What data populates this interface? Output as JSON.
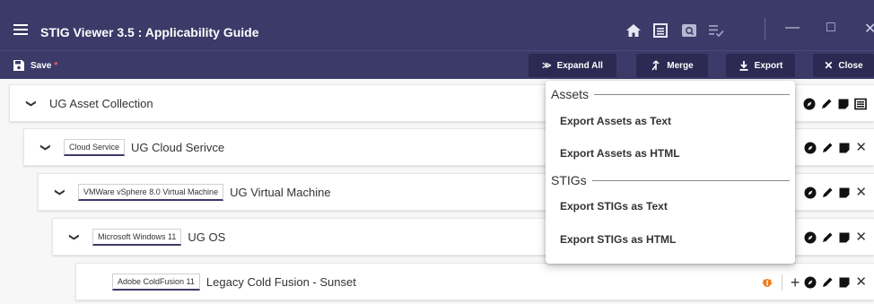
{
  "app": {
    "title": "STIG Viewer 3.5 : Applicability Guide"
  },
  "toolbar": {
    "save_label": "Save",
    "unsaved_marker": "*",
    "expand_all_label": "Expand All",
    "merge_label": "Merge",
    "export_label": "Export",
    "close_label": "Close"
  },
  "tree": {
    "rows": [
      {
        "chip": "",
        "label": "UG Asset Collection"
      },
      {
        "chip": "Cloud Service",
        "label": "UG Cloud Serivce"
      },
      {
        "chip": "VMWare vSphere 8.0 Virtual Machine",
        "label": "UG Virtual Machine"
      },
      {
        "chip": "Microsoft Windows 11",
        "label": "UG OS"
      },
      {
        "chip": "Adobe ColdFusion 11",
        "label": "Legacy Cold Fusion - Sunset"
      }
    ]
  },
  "export_menu": {
    "assets_header": "Assets",
    "export_assets_text": "Export Assets as Text",
    "export_assets_html": "Export Assets as HTML",
    "stigs_header": "STIGs",
    "export_stigs_text": "Export STIGs as Text",
    "export_stigs_html": "Export STIGs as HTML"
  },
  "colors": {
    "header_bg": "#3c3a68",
    "accent_red": "#ff5a5a",
    "status_orange": "#f07a1a"
  }
}
